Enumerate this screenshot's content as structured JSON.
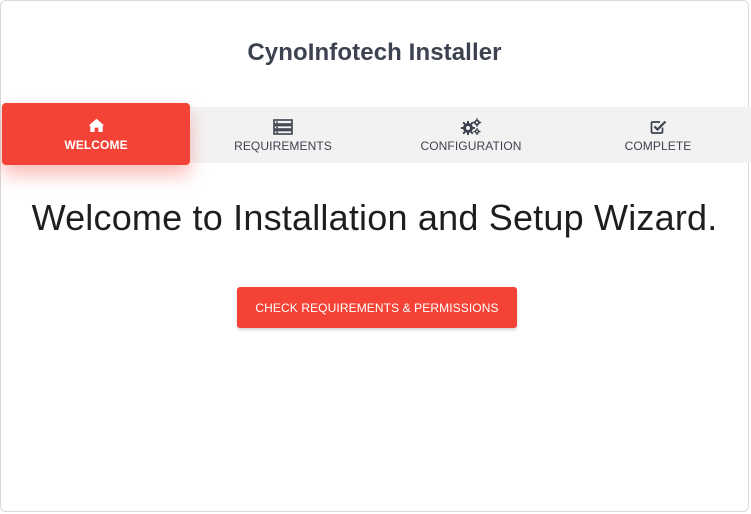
{
  "app": {
    "title": "CynoInfotech Installer"
  },
  "steps": [
    {
      "label": "WELCOME",
      "icon": "home-icon",
      "active": true
    },
    {
      "label": "REQUIREMENTS",
      "icon": "server-list-icon",
      "active": false
    },
    {
      "label": "CONFIGURATION",
      "icon": "gears-icon",
      "active": false
    },
    {
      "label": "COMPLETE",
      "icon": "checkbox-icon",
      "active": false
    }
  ],
  "main": {
    "heading": "Welcome to Installation and Setup Wizard.",
    "primary_button_label": "CHECK REQUIREMENTS & PERMISSIONS"
  },
  "colors": {
    "accent": "#f44336",
    "title_text": "#3d4250",
    "steps_bar_bg": "#f2f2f2",
    "heading_text": "#1e1e1e"
  }
}
